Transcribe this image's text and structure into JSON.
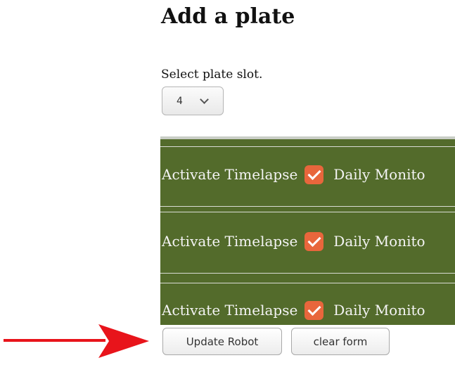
{
  "page": {
    "title": "Add a plate"
  },
  "slot": {
    "label": "Select plate slot.",
    "value": "4"
  },
  "plate_rows": [
    {
      "timelapse_label": "Activate Timelapse",
      "timelapse_checked": true,
      "daily_label": "Daily Monito"
    },
    {
      "timelapse_label": "Activate Timelapse",
      "timelapse_checked": true,
      "daily_label": "Daily Monito"
    },
    {
      "timelapse_label": "Activate Timelapse",
      "timelapse_checked": true,
      "daily_label": "Daily Monito"
    }
  ],
  "buttons": {
    "update": "Update Robot",
    "clear": "clear form"
  },
  "colors": {
    "panel_bg": "#536b2b",
    "checkbox": "#e8663c",
    "arrow": "#e8141b"
  },
  "icons": {
    "arrow": "red-arrow-icon",
    "check": "checkmark-icon"
  }
}
